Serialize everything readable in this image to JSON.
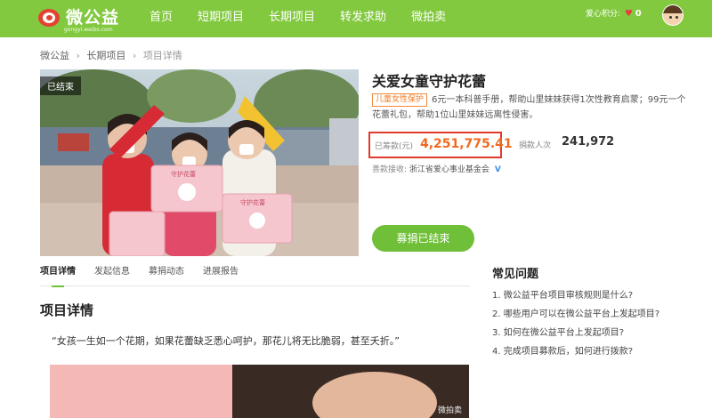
{
  "nav": {
    "logo_text": "微公益",
    "logo_sub": "gongyi.weibo.com",
    "items": [
      "首页",
      "短期项目",
      "长期项目",
      "转发求助",
      "微拍卖"
    ],
    "points_label": "爱心积分:",
    "points_value": "0"
  },
  "breadcrumb": [
    "微公益",
    "长期项目",
    "项目详情"
  ],
  "project": {
    "status_tag": "已结束",
    "title": "关爱女童守护花蕾",
    "category": "儿童女性保护",
    "description": "6元一本科普手册，帮助山里妹妹获得1次性教育启蒙；99元一个花蕾礼包，帮助1位山里妹妹远离性侵害。",
    "raised_label": "已筹款(元)",
    "raised_amount": "4,251,775.41",
    "donors_label": "捐款人次",
    "donors_count": "241,972",
    "receiver_label": "善款接收:",
    "receiver_org": "浙江省爱心事业基金会",
    "status_button": "募捐已结束"
  },
  "hero_image": {
    "bag_label": "守护花蕾"
  },
  "tabs": [
    "项目详情",
    "发起信息",
    "募捐动态",
    "进展报告"
  ],
  "detail": {
    "title": "项目详情",
    "quote": "“女孩一生如一个花期，如果花蕾缺乏悉心呵护，那花儿将无比脆弱，甚至夭折。”",
    "image_watermark": "微拍卖"
  },
  "faq": {
    "title": "常见问题",
    "items": [
      "1. 微公益平台项目审核规则是什么?",
      "2. 哪些用户可以在微公益平台上发起项目?",
      "3. 如何在微公益平台上发起项目?",
      "4. 完成项目募款后，如何进行拨款?"
    ]
  },
  "colors": {
    "nav_bg": "#82c93f",
    "accent_green": "#6fbf38",
    "amount_orange": "#f06a1f",
    "highlight_red": "#e03a2f"
  }
}
